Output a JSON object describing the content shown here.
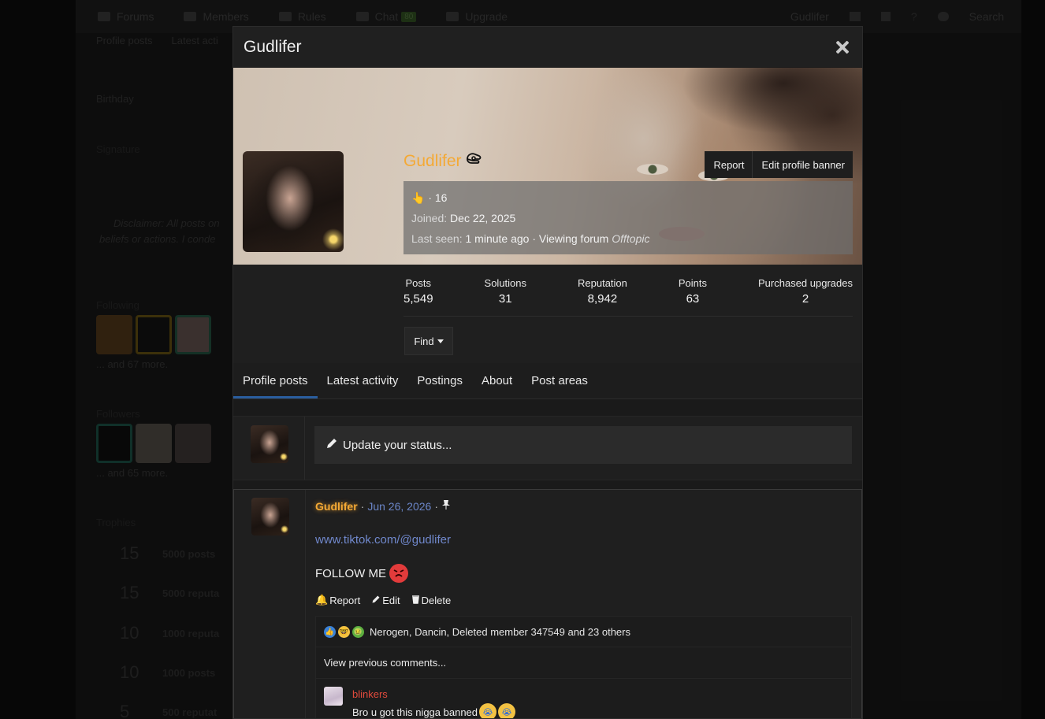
{
  "background": {
    "nav": [
      "Forums",
      "Members",
      "Rules",
      "Chat",
      "Upgrade"
    ],
    "chat_badge": "80",
    "nav_right_user": "Gudlifer",
    "nav_search": "Search",
    "subnav": [
      "Profile posts",
      "Latest acti"
    ],
    "birthday_label": "Birthday",
    "signature_label": "Signature",
    "disclaimer": [
      "Disclaimer: All posts on",
      "beliefs or actions. I conde"
    ],
    "following_label": "Following",
    "following_more": "... and 67 more.",
    "followers_label": "Followers",
    "followers_more": "... and 65 more.",
    "trophies_label": "Trophies",
    "trophies": [
      {
        "num": "15",
        "text": "5000 posts"
      },
      {
        "num": "15",
        "text": "5000 reputa"
      },
      {
        "num": "10",
        "text": "1000 reputa"
      },
      {
        "num": "10",
        "text": "1000 posts"
      },
      {
        "num": "5",
        "text": "500 reputat"
      }
    ]
  },
  "modal": {
    "title": "Gudlifer",
    "close_icon": "close-icon",
    "username": "Gudlifer",
    "username_color": "#f4a935",
    "banner_actions": {
      "report": "Report",
      "edit_banner": "Edit profile banner"
    },
    "info": {
      "emoji": "👆",
      "age_line": "· 16",
      "joined_label": "Joined:",
      "joined_value": "Dec 22, 2025",
      "last_seen_label": "Last seen:",
      "last_seen_value": "1 minute ago · Viewing forum",
      "last_seen_forum": "Offtopic"
    },
    "stats": [
      {
        "label": "Posts",
        "value": "5,549"
      },
      {
        "label": "Solutions",
        "value": "31"
      },
      {
        "label": "Reputation",
        "value": "8,942"
      },
      {
        "label": "Points",
        "value": "63"
      },
      {
        "label": "Purchased upgrades",
        "value": "2"
      }
    ],
    "find_label": "Find",
    "tabs": [
      "Profile posts",
      "Latest activity",
      "Postings",
      "About",
      "Post areas"
    ],
    "active_tab": "Profile posts",
    "status_placeholder": "Update your status...",
    "post": {
      "author": "Gudlifer",
      "date": "Jun 26, 2026",
      "link": "www.tiktok.com/@gudlifer",
      "text": "FOLLOW ME",
      "actions": {
        "report": "Report",
        "edit": "Edit",
        "delete": "Delete"
      },
      "reactions": "Nerogen, Dancin, Deleted member 347549 and 23 others",
      "view_previous": "View previous comments...",
      "comment": {
        "author": "blinkers",
        "text": "Bro u got this nigga banned"
      }
    }
  }
}
